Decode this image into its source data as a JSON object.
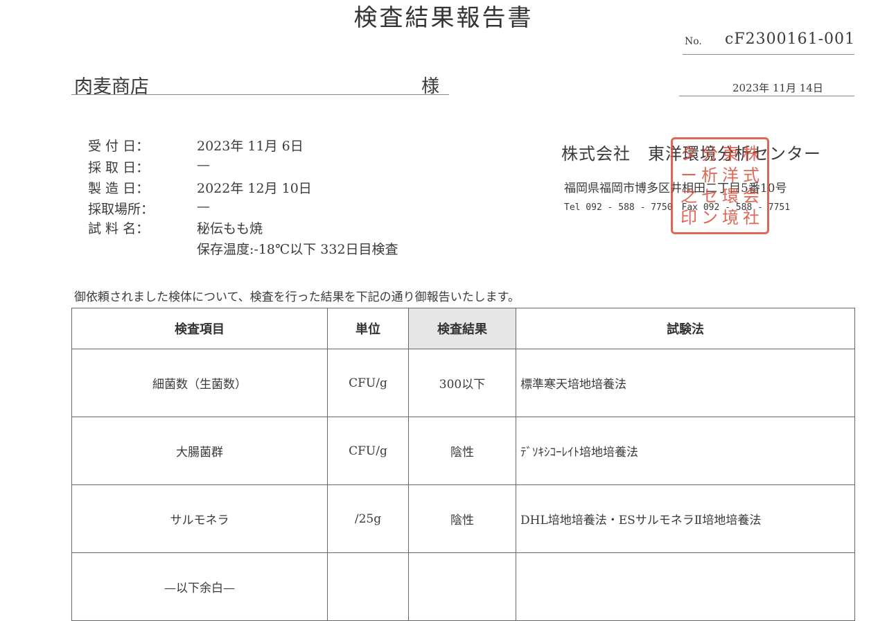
{
  "title": "検査結果報告書",
  "report_no_label": "No.",
  "report_no": "cF2300161-001",
  "client": "肉麦商店",
  "honorific": "様",
  "issue_date": "2023年 11月 14日",
  "info": [
    {
      "label": "受 付 日：",
      "value": "2023年 11月 6日"
    },
    {
      "label": "採 取 日：",
      "value": "—"
    },
    {
      "label": "製 造 日：",
      "value": "2022年 12月 10日"
    },
    {
      "label": "採取場所：",
      "value": "—"
    },
    {
      "label": "試 料 名：",
      "value": "秘伝もも焼"
    }
  ],
  "sample_note": "保存温度:-18℃以下 332日目検査",
  "company": "株式会社　東洋環境分析センター",
  "address": "福岡県福岡市博多区井相田二丁目5番10号",
  "tel": "Tel 092 - 588 - 7750　Fax 092 - 588 - 7751",
  "stamp_chars": [
    "株",
    "式",
    "会",
    "社",
    "東",
    "洋",
    "環",
    "境",
    "分",
    "析",
    "セ",
    "ン",
    "タ",
    "ー",
    "之",
    "印"
  ],
  "intro": "御依頼されました検体について、検査を行った結果を下記の通り御報告いたします。",
  "table": {
    "headers": [
      "検査項目",
      "単位",
      "検査結果",
      "試験法"
    ],
    "rows": [
      {
        "item": "細菌数（生菌数）",
        "unit": "CFU/g",
        "result": "300以下",
        "method": "標準寒天培地培養法"
      },
      {
        "item": "大腸菌群",
        "unit": "CFU/g",
        "result": "陰性",
        "method": "ﾃﾞｿｷｼｺｰﾚｲﾄ培地培養法"
      },
      {
        "item": "サルモネラ",
        "unit": "/25g",
        "result": "陰性",
        "method": "DHL培地培養法・ESサルモネラⅡ培地培養法"
      },
      {
        "item": "—以下余白—",
        "unit": "",
        "result": "",
        "method": ""
      }
    ]
  },
  "colors": {
    "stamp": "#d8452f",
    "header_shade": "#e6e6e6",
    "text": "#3a3a3a"
  }
}
